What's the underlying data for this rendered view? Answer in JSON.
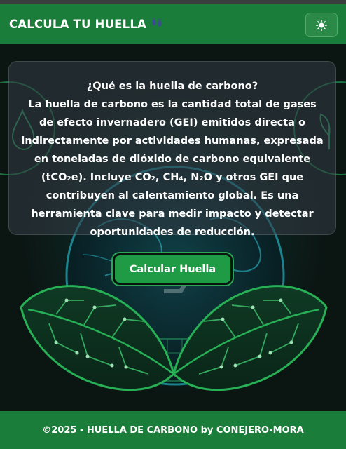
{
  "header": {
    "title": "CALCULA TU HUELLA",
    "title_icon": "footprints-icon",
    "theme_toggle_icon": "sun-icon"
  },
  "info_card": {
    "heading": "¿Qué es la huella de carbono?",
    "body": "La huella de carbono es la cantidad total de gases de efecto invernadero (GEI) emitidos directa o indirectamente por actividades humanas, expresada en toneladas de dióxido de carbono equivalente (tCO₂e). Incluye CO₂, CH₄, N₂O y otros GEI que contribuyen al calentamiento global. Es una herramienta clave para medir impacto y detectar oportunidades de reducción."
  },
  "cta": {
    "label": "Calcular Huella"
  },
  "footer": {
    "text": "©2025 - HUELLA DE CARBONO by CONEJERO-MORA"
  },
  "colors": {
    "header_bg": "#1b7d3a",
    "page_bg": "#0b1512",
    "button_bg": "#1f9a45",
    "art_green": "#1fa84b",
    "art_teal": "#1fa8b8"
  }
}
